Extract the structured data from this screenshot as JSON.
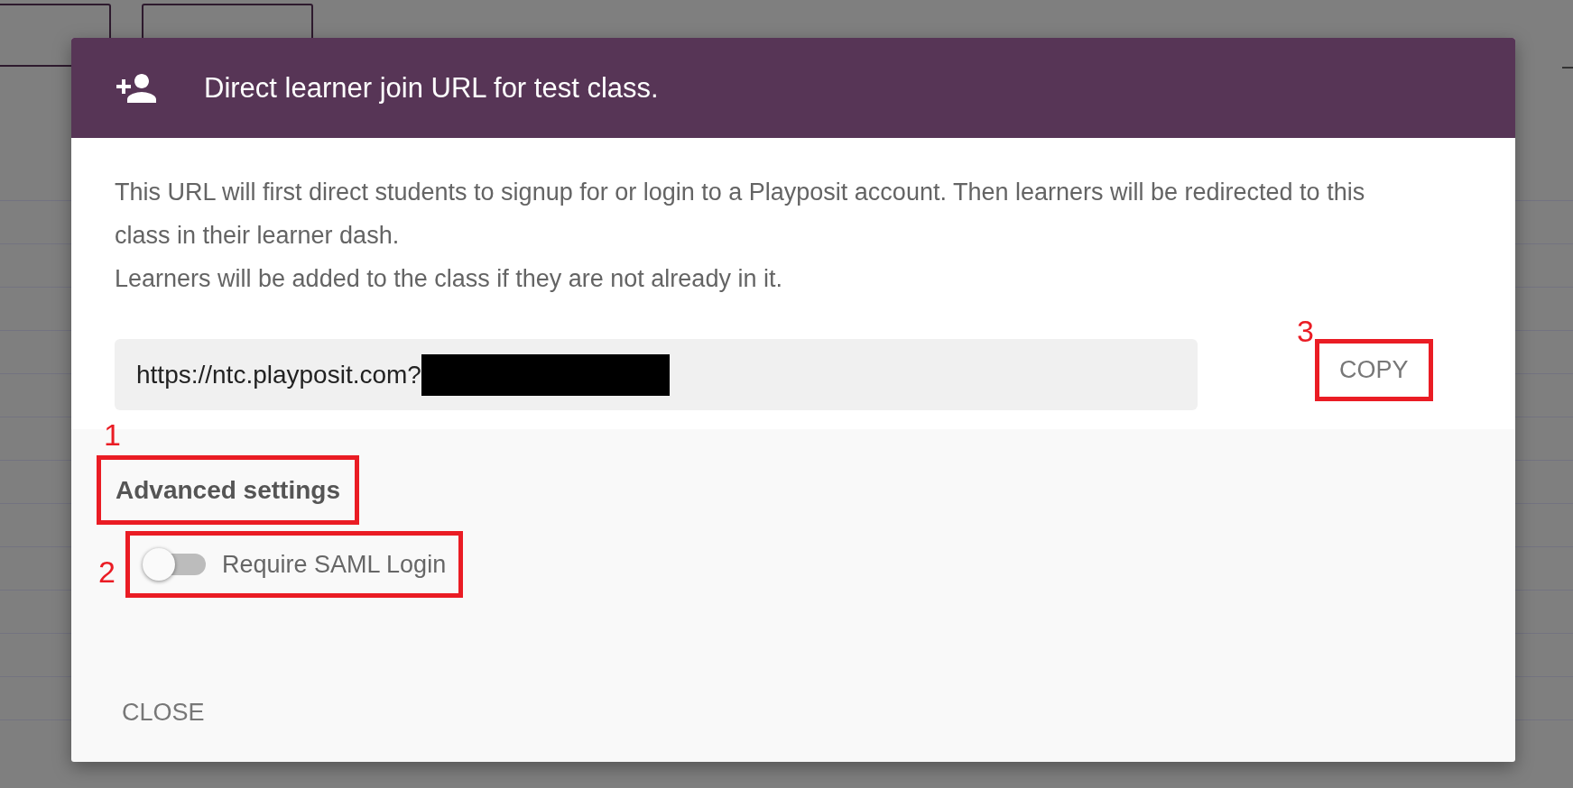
{
  "dialog": {
    "title": "Direct learner join URL for test class.",
    "paragraphs": [
      "This URL will first direct students to signup for or login to a Playposit account. Then learners will be redirected to this class in their learner dash.",
      "Learners will be added to the class if they are not already in it."
    ],
    "url_field": {
      "value": "https://ntc.playposit.com?",
      "redacted": true
    },
    "copy_button": {
      "label": "COPY",
      "annotation": "3"
    },
    "advanced_heading": {
      "text": "Advanced settings",
      "annotation": "1"
    },
    "saml_toggle": {
      "label": "Require SAML Login",
      "on": false,
      "annotation": "2"
    },
    "close_button": "CLOSE"
  }
}
